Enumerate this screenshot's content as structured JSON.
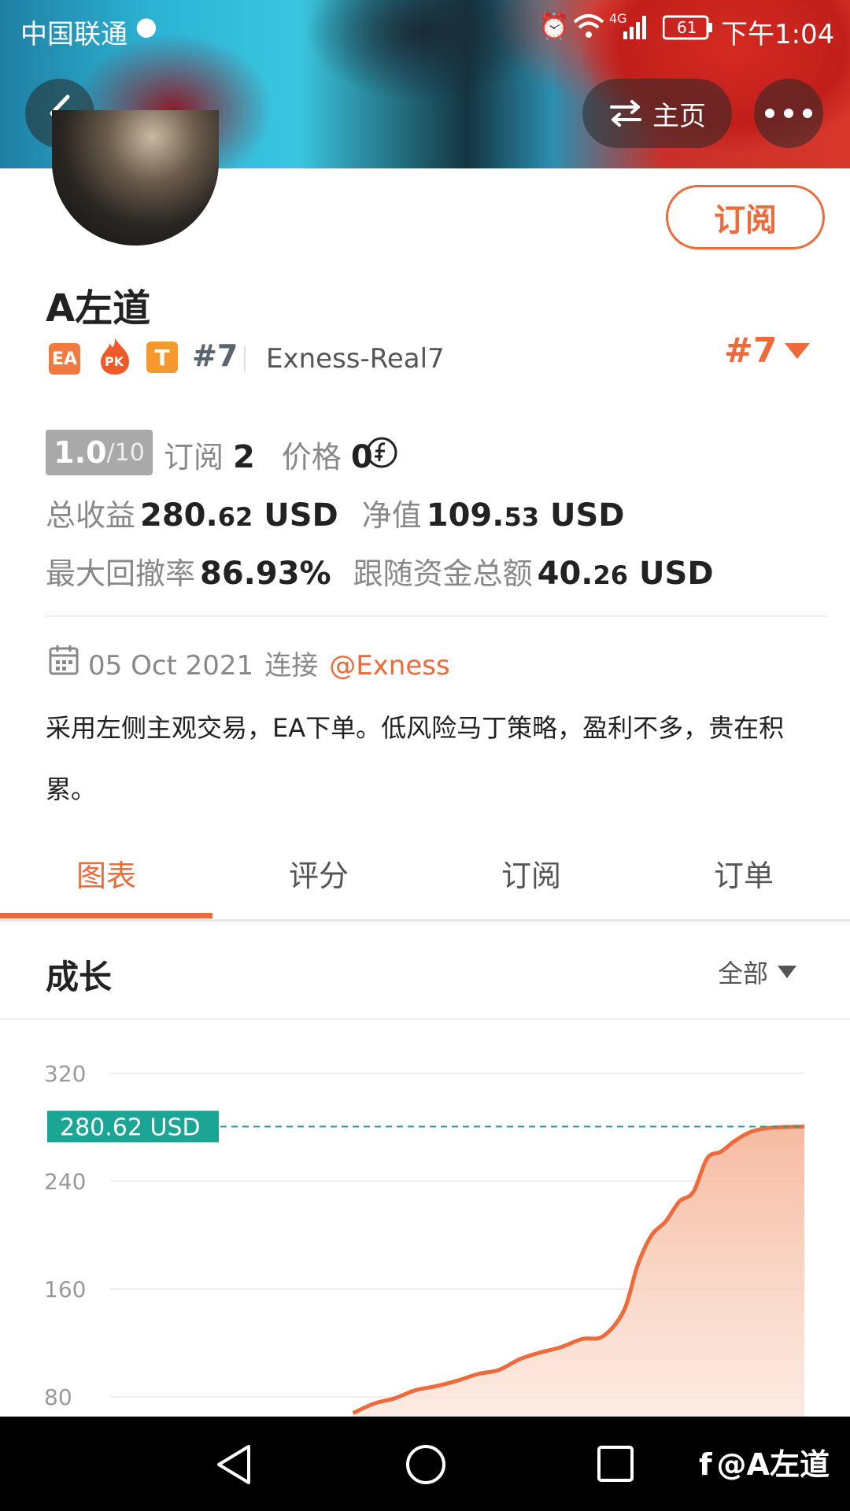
{
  "status_bar": {
    "carrier": "中国联通",
    "battery": "61",
    "time": "下午1:04"
  },
  "header": {
    "home_label": "主页"
  },
  "profile": {
    "subscribe_button": "订阅",
    "name": "A左道",
    "badges": [
      "EA",
      "PK",
      "T"
    ],
    "rank_text": "#7",
    "server": "Exness-Real7",
    "rank_dropdown": "#7"
  },
  "stats": {
    "rating": {
      "score": "1.0",
      "max": "/10"
    },
    "subscribe_label": "订阅",
    "subscribe_count": "2",
    "price_label": "价格",
    "price_value": "0",
    "total_profit_label": "总收益",
    "total_profit_int": "280.",
    "total_profit_dec": "62",
    "total_profit_unit": "USD",
    "equity_label": "净值",
    "equity_int": "109.",
    "equity_dec": "53",
    "equity_unit": "USD",
    "max_drawdown_label": "最大回撤率",
    "max_drawdown_value": "86.93%",
    "follow_funds_label": "跟随资金总额",
    "follow_funds_int": "40.",
    "follow_funds_dec": "26",
    "follow_funds_unit": "USD"
  },
  "connection": {
    "date": "05 Oct 2021",
    "connect_label": "连接",
    "broker": "@Exness"
  },
  "description": "采用左侧主观交易，EA下单。低风险马丁策略，盈利不多，贵在积累。",
  "tabs": [
    {
      "label": "图表",
      "active": true
    },
    {
      "label": "评分",
      "active": false
    },
    {
      "label": "订阅",
      "active": false
    },
    {
      "label": "订单",
      "active": false
    }
  ],
  "growth": {
    "title": "成长",
    "range_selector": "全部"
  },
  "colors": {
    "accent": "#ef6a3a",
    "teal": "#1aa595",
    "fill": "#f7c4ad"
  },
  "chart_data": {
    "type": "area",
    "yticks": [
      320,
      240,
      160,
      80
    ],
    "ylim": [
      68,
      330
    ],
    "current_label": "280.62 USD",
    "current_value": 280.62,
    "x": [
      0.35,
      0.38,
      0.41,
      0.44,
      0.47,
      0.5,
      0.53,
      0.56,
      0.59,
      0.62,
      0.65,
      0.68,
      0.71,
      0.74,
      0.76,
      0.78,
      0.8,
      0.82,
      0.84,
      0.86,
      0.88,
      0.9,
      0.92,
      0.94,
      0.96,
      1.0
    ],
    "y": [
      68,
      75,
      79,
      85,
      88,
      92,
      97,
      100,
      108,
      113,
      117,
      123,
      125,
      144,
      178,
      200,
      210,
      225,
      232,
      257,
      262,
      270,
      276,
      279,
      280,
      280.62
    ]
  }
}
